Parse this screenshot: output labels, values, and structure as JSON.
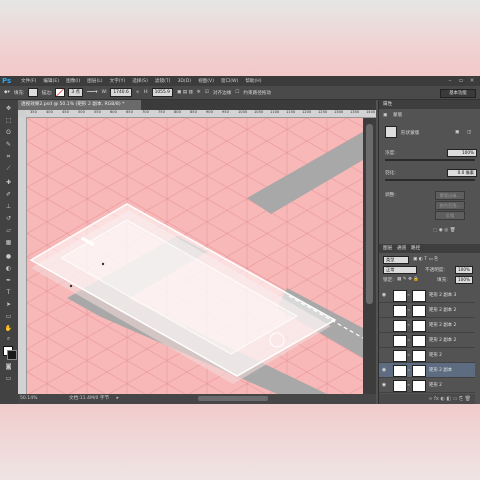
{
  "app": {
    "logo": "Ps"
  },
  "menu": [
    "文件(F)",
    "编辑(E)",
    "图像(I)",
    "图层(L)",
    "文字(Y)",
    "选择(S)",
    "滤镜(T)",
    "3D(D)",
    "视图(V)",
    "窗口(W)",
    "帮助(H)"
  ],
  "options_bar": {
    "fill_label": "填充:",
    "stroke_label": "描边:",
    "stroke_width": "3 点",
    "w_label": "W:",
    "w_value": "1740.6",
    "h_label": "H:",
    "h_value": "1055.9",
    "align_edges": "对齐边缘",
    "constrain_path": "约束路径拖动",
    "workspace": "基本功能",
    "stroke_swatch_color": "#ffffff",
    "fill_swatch_color": "#dddddd"
  },
  "document": {
    "tab_title": "透视效果2.psd @ 50.1% (矩形 2 副本, RGB/8) *",
    "zoom": "50.14%",
    "doc_size": "文档:11.4M/0 字节",
    "ruler_ticks": [
      "350",
      "400",
      "450",
      "500",
      "550",
      "600",
      "650",
      "700",
      "750",
      "800",
      "850",
      "900",
      "950",
      "1000",
      "1050",
      "1100",
      "1150",
      "1200",
      "1250",
      "1300",
      "1350",
      "1400"
    ]
  },
  "colors": {
    "canvas_bg": "#f8b8b8",
    "grid_line": "#e9999d",
    "shadow_gray": "#a9a9a9",
    "phone_white": "#ffffff",
    "accent_selected_layer": "#5d6c80",
    "ps_blue": "#2fa3e6"
  },
  "properties_panel": {
    "tab": "属性",
    "section": "蒙版",
    "shape_label": "形状蒙版",
    "density_label": "浓度:",
    "density_value": "100%",
    "feather_label": "羽化:",
    "feather_value": "0.0 像素",
    "refine_label": "调整:",
    "btn_edge": "蒙版边缘...",
    "btn_color_range": "颜色范围...",
    "btn_invert": "反相"
  },
  "layers_panel": {
    "tabs": [
      "图层",
      "通道",
      "路径"
    ],
    "filter_kind": "类型",
    "blend_mode": "正常",
    "opacity_label": "不透明度:",
    "opacity_value": "100%",
    "lock_label": "锁定:",
    "fill_label": "填充:",
    "fill_value": "100%",
    "layers": [
      {
        "name": "矩形 2 副本 3",
        "visible": true,
        "selected": false
      },
      {
        "name": "矩形 2 副本 2",
        "visible": false,
        "selected": false
      },
      {
        "name": "矩形 2 副本 2",
        "visible": false,
        "selected": false
      },
      {
        "name": "矩形 2 副本 2",
        "visible": false,
        "selected": false
      },
      {
        "name": "矩形 2",
        "visible": false,
        "selected": false
      },
      {
        "name": "矩形 2 副本",
        "visible": true,
        "selected": true
      },
      {
        "name": "矩形 2",
        "visible": true,
        "selected": false
      }
    ]
  },
  "tools": [
    "move-icon",
    "marquee-icon",
    "lasso-icon",
    "quick-select-icon",
    "crop-icon",
    "eyedropper-icon",
    "healing-icon",
    "brush-icon",
    "stamp-icon",
    "history-brush-icon",
    "eraser-icon",
    "gradient-icon",
    "blur-icon",
    "dodge-icon",
    "pen-icon",
    "type-icon",
    "path-select-icon",
    "shape-icon",
    "hand-icon",
    "zoom-icon"
  ]
}
